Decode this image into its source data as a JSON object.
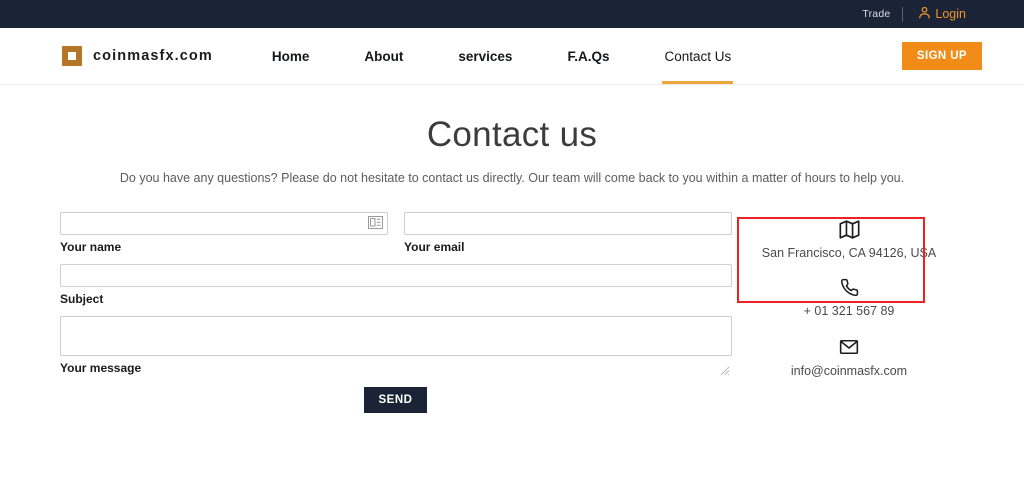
{
  "topbar": {
    "trade_label": "Trade",
    "login_label": "Login",
    "login_icon": "person-icon",
    "bg_color": "#1b2436",
    "accent_color": "#f0922b"
  },
  "navbar": {
    "brand_name": "coinmasfx.com",
    "brand_logo_icon": "square-logo-icon",
    "brand_logo_color": "#b5762a",
    "links": [
      {
        "label": "Home",
        "active": false
      },
      {
        "label": "About",
        "active": false
      },
      {
        "label": "services",
        "active": false
      },
      {
        "label": "F.A.Qs",
        "active": false
      },
      {
        "label": "Contact Us",
        "active": true
      }
    ],
    "signup_label": "SIGN UP",
    "signup_color": "#f28c18",
    "active_underline_color": "#eda63b"
  },
  "page": {
    "title": "Contact us",
    "subtitle": "Do you have any questions? Please do not hesitate to contact us directly. Our team will come back to you within a matter of hours to help you."
  },
  "form": {
    "name_field": {
      "value": "",
      "placeholder": "",
      "label": "Your name",
      "icon": "contact-card-autofill-icon"
    },
    "email_field": {
      "value": "",
      "placeholder": "",
      "label": "Your email"
    },
    "subject_field": {
      "value": "",
      "placeholder": "",
      "label": "Subject"
    },
    "message_field": {
      "value": "",
      "placeholder": "",
      "label": "Your message"
    },
    "send_label": "SEND",
    "send_color": "#1b2436"
  },
  "contact_info": {
    "address_icon": "map-icon",
    "address": "San Francisco, CA 94126, USA",
    "phone_icon": "phone-icon",
    "phone": "+ 01 321 567 89",
    "email_icon": "envelope-icon",
    "email": "info@coinmasfx.com"
  },
  "annotation": {
    "color": "#ee2222",
    "note": "highlight-box"
  }
}
